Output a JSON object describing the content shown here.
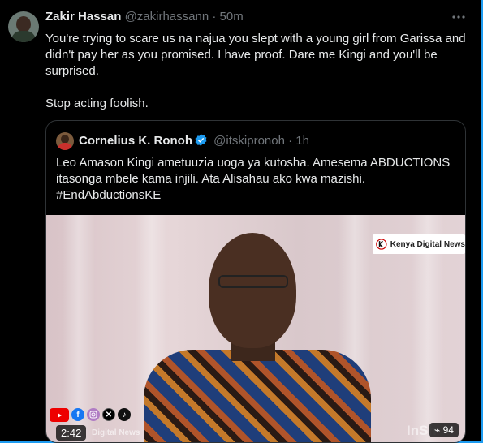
{
  "tweet": {
    "author_name": "Zakir Hassan",
    "author_handle": "@zakirhassann",
    "separator": "·",
    "time": "50m",
    "more_icon": "more-dots-icon",
    "text_line1": "You're trying to scare us na najua you slept with a young girl from Garissa and didn't pay her as you promised. I have proof. Dare me Kingi and you'll be surprised.",
    "text_line2": "Stop acting foolish."
  },
  "quote": {
    "author_name": "Cornelius K. Ronoh",
    "author_handle": "@itskipronoh",
    "separator": "·",
    "time": "1h",
    "text": "Leo Amason Kingi ametuuzia uoga ya kutosha. Amesema ABDUCTIONS itasonga mbele kama injili. Ata Alisahau ako kwa mazishi. #EndAbductionsKE",
    "verified_color": "#1d9bf0"
  },
  "media": {
    "logo_text": "Kenya Digital News",
    "duration": "2:42",
    "watermark_left": "Digital News",
    "watermark_right": "InSh",
    "views": "94"
  },
  "colors": {
    "accent": "#1d9bf0",
    "text": "#e7e9ea",
    "muted": "#71767b",
    "background": "#000000"
  }
}
